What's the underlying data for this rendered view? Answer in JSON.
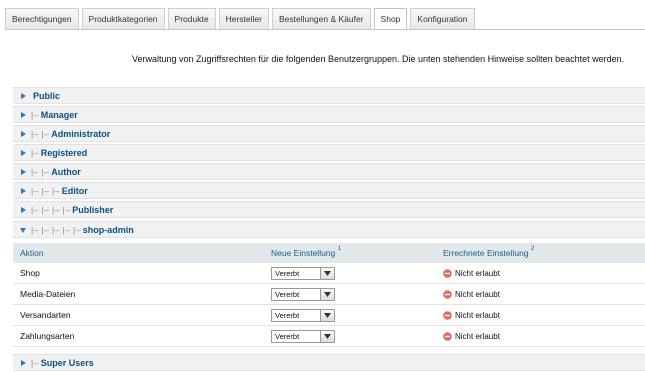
{
  "tabs": [
    "Berechtigungen",
    "Produktkategorien",
    "Produkte",
    "Hersteller",
    "Bestellungen & Käufer",
    "Shop",
    "Konfiguration"
  ],
  "active_tab": "Shop",
  "intro": "Verwaltung von Zugriffsrechten für die folgenden Benutzergruppen. Die unten stehenden Hinweise sollten beachtet werden.",
  "groups": [
    {
      "pipes": "",
      "name": "Public"
    },
    {
      "pipes": "|–",
      "name": "Manager"
    },
    {
      "pipes": "|– |–",
      "name": "Administrator"
    },
    {
      "pipes": "|–",
      "name": "Registered"
    },
    {
      "pipes": "|– |–",
      "name": "Author"
    },
    {
      "pipes": "|– |– |–",
      "name": "Editor"
    },
    {
      "pipes": "|– |– |– |–",
      "name": "Publisher"
    },
    {
      "pipes": "|– |– |– |– |–",
      "name": "shop-admin"
    },
    {
      "pipes": "|–",
      "name": "Super Users"
    }
  ],
  "expanded_group": "shop-admin",
  "table": {
    "col_action": "Aktion",
    "col_new": "Neue Einstellung",
    "col_new_sup": "1",
    "col_calc": "Errechnete Einstellung",
    "col_calc_sup": "2",
    "rows": [
      {
        "action": "Shop",
        "setting": "Vererbt",
        "calculated": "Nicht erlaubt"
      },
      {
        "action": "Media-Dateien",
        "setting": "Vererbt",
        "calculated": "Nicht erlaubt"
      },
      {
        "action": "Versandarten",
        "setting": "Vererbt",
        "calculated": "Nicht erlaubt"
      },
      {
        "action": "Zahlungsarten",
        "setting": "Vererbt",
        "calculated": "Nicht erlaubt"
      }
    ]
  },
  "icons": {
    "collapsed": "arrow-right-icon",
    "expanded": "arrow-down-icon",
    "dropdown": "chevron-down-icon",
    "denied": "deny-icon"
  },
  "colors": {
    "link": "#0b4f80",
    "header_text": "#1c5f87",
    "arrow": "#2e7ab8",
    "deny": "#e06a5b"
  }
}
